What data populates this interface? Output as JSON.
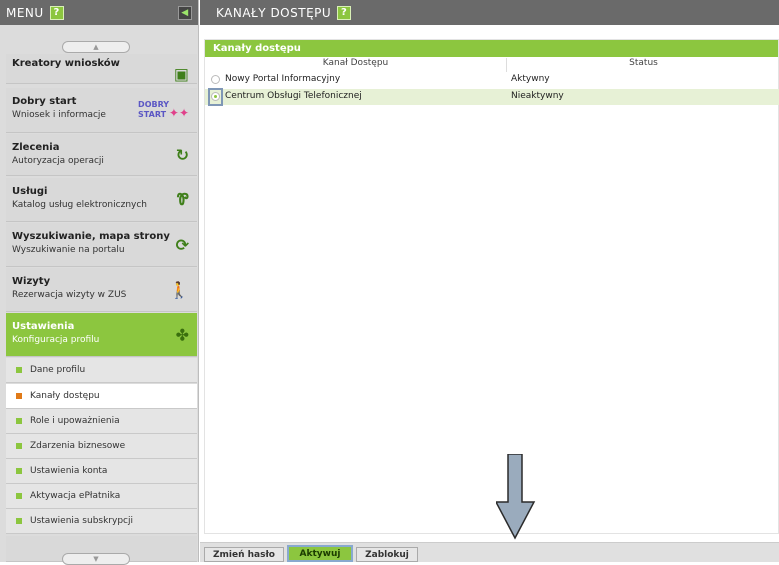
{
  "menu": {
    "header": "MENU",
    "help": "?",
    "items": [
      {
        "title": "Kreatory wniosków",
        "subtitle": "",
        "icon": "form-icon"
      },
      {
        "title": "Dobry start",
        "subtitle": "Wniosek i informacje",
        "icon": "dobry-start-logo"
      },
      {
        "title": "Zlecenia",
        "subtitle": "Autoryzacja operacji",
        "icon": "refresh-icon"
      },
      {
        "title": "Usługi",
        "subtitle": "Katalog usług elektronicznych",
        "icon": "fork-icon"
      },
      {
        "title": "Wyszukiwanie, mapa strony",
        "subtitle": "Wyszukiwanie na portalu",
        "icon": "sync-icon"
      },
      {
        "title": "Wizyty",
        "subtitle": "Rezerwacja wizyty w ZUS",
        "icon": "walk-icon"
      },
      {
        "title": "Ustawienia",
        "subtitle": "Konfiguracja profilu",
        "icon": "puzzle-icon"
      }
    ],
    "sub_items": [
      {
        "label": "Dane profilu",
        "active": false
      },
      {
        "label": "Kanały dostępu",
        "active": true
      },
      {
        "label": "Role i upoważnienia",
        "active": false
      },
      {
        "label": "Zdarzenia biznesowe",
        "active": false
      },
      {
        "label": "Ustawienia konta",
        "active": false
      },
      {
        "label": "Aktywacja ePłatnika",
        "active": false
      },
      {
        "label": "Ustawienia subskrypcji",
        "active": false
      }
    ]
  },
  "main": {
    "header": "KANAŁY DOSTĘPU",
    "help": "?",
    "panel_title": "Kanały dostępu",
    "columns": [
      "Kanał Dostępu",
      "Status"
    ],
    "rows": [
      {
        "name": "Nowy Portal Informacyjny",
        "status": "Aktywny",
        "selected": false
      },
      {
        "name": "Centrum Obsługi Telefonicznej",
        "status": "Nieaktywny",
        "selected": true
      }
    ],
    "buttons": [
      "Zmień hasło",
      "Aktywuj",
      "Zablokuj"
    ]
  },
  "colors": {
    "accent": "#8cc63f",
    "header_bg": "#6a6a6a",
    "selected_row": "#e7f1d6",
    "active_bullet": "#e07a18"
  }
}
